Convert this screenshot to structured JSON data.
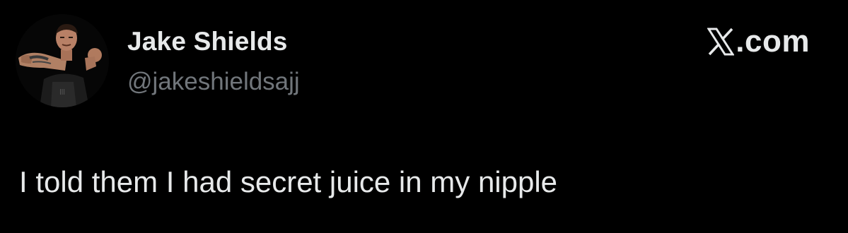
{
  "tweet": {
    "author_name": "Jake Shields",
    "author_handle": "@jakeshieldsajj",
    "text": "I told them I had secret juice in my nipple",
    "avatar_icon": "profile-photo-avatar"
  },
  "brand": {
    "logo_icon": "x-logo-icon",
    "label": ".com"
  },
  "colors": {
    "background": "#000000",
    "primary_text": "#e7e9ea",
    "secondary_text": "#71767b"
  }
}
